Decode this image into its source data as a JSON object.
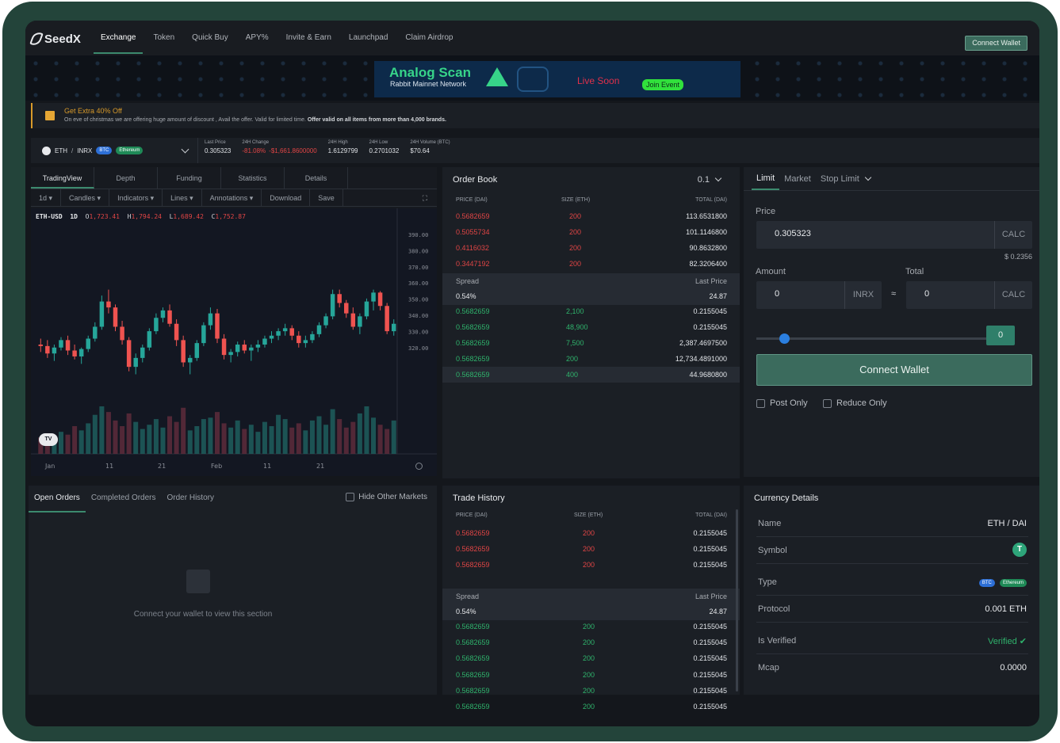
{
  "brand": "SeedX",
  "nav": {
    "links": [
      "Exchange",
      "Token",
      "Quick Buy",
      "APY%",
      "Invite & Earn",
      "Launchpad",
      "Claim Airdrop"
    ],
    "connect_label": "Connect Wallet"
  },
  "ad": {
    "title": "Analog Scan",
    "subtitle": "Rabbit Mainnet Network",
    "live": "Live Soon",
    "join": "Join Event"
  },
  "promo": {
    "title": "Get Extra 40% Off",
    "text": "On eve of christmas we are offering huge amount of discount , Avail the offer. Valid for limited time.",
    "bold": "Offer valid on all items from more than 4,000 brands."
  },
  "ticker": {
    "base": "ETH",
    "sep": "/",
    "quote": "INRX",
    "badges": [
      "BTC",
      "Ethereum"
    ],
    "stats": [
      {
        "label": "Last Price",
        "values": [
          "0.305323"
        ],
        "colors": [
          "#dfe2e6"
        ]
      },
      {
        "label": "24H Change",
        "values": [
          "-81.08%",
          "-$1,661.8600000"
        ],
        "colors": [
          "#e04545",
          "#e04545"
        ]
      },
      {
        "label": "24H High",
        "values": [
          "1.6129799"
        ],
        "colors": [
          "#dfe2e6"
        ]
      },
      {
        "label": "24H Low",
        "values": [
          "0.2701032"
        ],
        "colors": [
          "#dfe2e6"
        ]
      },
      {
        "label": "24H Volume (BTC)",
        "values": [
          "$70.64"
        ],
        "colors": [
          "#dfe2e6"
        ]
      }
    ]
  },
  "chart_panel": {
    "tabs": [
      "TradingView",
      "Depth",
      "Funding",
      "Statistics",
      "Details"
    ],
    "tools": [
      "1d ▾",
      "Candles ▾",
      "Indicators ▾",
      "Lines ▾",
      "Annotations ▾",
      "Download",
      "Save"
    ],
    "expand": "⛶",
    "ohlc": {
      "symbol": "ETH-USD",
      "interval": "1D",
      "o": "1,723.41",
      "h": "1,794.24",
      "l": "1,689.42",
      "c": "1,752.87"
    },
    "tv_logo": "TV"
  },
  "chart_data": {
    "type": "candlestick",
    "symbol": "ETH-USD",
    "yticks": [
      "390.00",
      "380.00",
      "370.00",
      "360.00",
      "350.00",
      "340.00",
      "330.00",
      "320.00"
    ],
    "ylim": [
      315,
      395
    ],
    "xticks": [
      "Jan",
      "11",
      "21",
      "Feb",
      "11",
      "21"
    ],
    "up_color": "#26a69a",
    "down_color": "#ef5350",
    "candles": [
      [
        331,
        335,
        326,
        330
      ],
      [
        330,
        334,
        322,
        325
      ],
      [
        325,
        331,
        320,
        329
      ],
      [
        329,
        336,
        327,
        334
      ],
      [
        334,
        337,
        324,
        327
      ],
      [
        327,
        331,
        321,
        323
      ],
      [
        323,
        329,
        318,
        328
      ],
      [
        328,
        337,
        326,
        335
      ],
      [
        335,
        346,
        333,
        343
      ],
      [
        343,
        364,
        341,
        360
      ],
      [
        360,
        368,
        352,
        356
      ],
      [
        356,
        358,
        340,
        343
      ],
      [
        343,
        347,
        331,
        334
      ],
      [
        334,
        336,
        313,
        316
      ],
      [
        316,
        325,
        311,
        322
      ],
      [
        322,
        331,
        319,
        329
      ],
      [
        329,
        342,
        327,
        340
      ],
      [
        340,
        352,
        338,
        349
      ],
      [
        349,
        356,
        346,
        354
      ],
      [
        354,
        358,
        343,
        345
      ],
      [
        345,
        348,
        330,
        334
      ],
      [
        334,
        337,
        316,
        319
      ],
      [
        319,
        324,
        311,
        322
      ],
      [
        322,
        334,
        320,
        332
      ],
      [
        332,
        346,
        330,
        344
      ],
      [
        344,
        356,
        341,
        352
      ],
      [
        352,
        355,
        332,
        335
      ],
      [
        335,
        338,
        321,
        324
      ],
      [
        324,
        328,
        319,
        326
      ],
      [
        326,
        333,
        323,
        331
      ],
      [
        331,
        334,
        325,
        327
      ],
      [
        327,
        331,
        320,
        329
      ],
      [
        329,
        334,
        326,
        331
      ],
      [
        331,
        337,
        329,
        335
      ],
      [
        335,
        340,
        332,
        337
      ],
      [
        337,
        342,
        334,
        340
      ],
      [
        340,
        345,
        337,
        342
      ],
      [
        342,
        344,
        334,
        337
      ],
      [
        337,
        340,
        329,
        332
      ],
      [
        332,
        337,
        329,
        334
      ],
      [
        334,
        340,
        332,
        338
      ],
      [
        338,
        346,
        336,
        344
      ],
      [
        344,
        352,
        342,
        350
      ],
      [
        350,
        368,
        348,
        365
      ],
      [
        365,
        368,
        356,
        359
      ],
      [
        359,
        361,
        349,
        352
      ],
      [
        352,
        356,
        341,
        343
      ],
      [
        343,
        352,
        338,
        350
      ],
      [
        350,
        362,
        348,
        360
      ],
      [
        360,
        368,
        354,
        366
      ],
      [
        366,
        367,
        354,
        357
      ],
      [
        357,
        359,
        338,
        340
      ],
      [
        340,
        348,
        337,
        345
      ]
    ],
    "volume": [
      6,
      9,
      7,
      10,
      8,
      14,
      11,
      16,
      22,
      28,
      24,
      18,
      14,
      23,
      17,
      12,
      15,
      19,
      13,
      21,
      17,
      27,
      11,
      14,
      19,
      20,
      24,
      16,
      13,
      18,
      12,
      15,
      10,
      17,
      14,
      22,
      19,
      13,
      16,
      11,
      18,
      21,
      15,
      26,
      19,
      13,
      17,
      23,
      28,
      20,
      15,
      12,
      18
    ]
  },
  "orderbook": {
    "title": "Order Book",
    "precision": "0.1",
    "headers": [
      "PRICE (DAI)",
      "SIZE (ETH)",
      "TOTAL (DAI)"
    ],
    "asks": [
      [
        "0.5682659",
        "200",
        "113.6531800"
      ],
      [
        "0.5055734",
        "200",
        "101.1146800"
      ],
      [
        "0.4116032",
        "200",
        "90.8632800"
      ],
      [
        "0.3447192",
        "200",
        "82.3206400"
      ]
    ],
    "spread_label": "Spread",
    "last_price_label": "Last Price",
    "spread_value": "0.54%",
    "last_price_value": "24.87",
    "bids": [
      [
        "0.5682659",
        "2,100",
        "0.2155045"
      ],
      [
        "0.5682659",
        "48,900",
        "0.2155045"
      ],
      [
        "0.5682659",
        "7,500",
        "2,387.4697500"
      ],
      [
        "0.5682659",
        "200",
        "12,734.4891000"
      ],
      [
        "0.5682659",
        "400",
        "44.9680800"
      ]
    ]
  },
  "trade_form": {
    "tabs": [
      "Limit",
      "Market",
      "Stop Limit"
    ],
    "price_label": "Price",
    "price_value": "0.305323",
    "calc_label": "CALC",
    "price_note": "$ 0.2356",
    "amount_label": "Amount",
    "total_label": "Total",
    "amount_value": "0",
    "amount_unit": "INRX",
    "approx": "≈",
    "total_value": "0",
    "slider_value": "0",
    "slider_level": 0.12,
    "connect_label": "Connect Wallet",
    "post_only": "Post Only",
    "reduce_only": "Reduce Only"
  },
  "orders": {
    "tabs": [
      "Open Orders",
      "Completed Orders",
      "Order History"
    ],
    "hide_other": "Hide Other Markets",
    "empty_message": "Connect your wallet to view this section"
  },
  "trade_history": {
    "title": "Trade History",
    "headers": [
      "PRICE (DAI)",
      "SIZE (ETH)",
      "TOTAL (DAI)"
    ],
    "sells": [
      [
        "0.5682659",
        "200",
        "0.2155045"
      ],
      [
        "0.5682659",
        "200",
        "0.2155045"
      ],
      [
        "0.5682659",
        "200",
        "0.2155045"
      ]
    ],
    "spread_label": "Spread",
    "last_price_label": "Last Price",
    "spread_value": "0.54%",
    "last_price_value": "24.87",
    "buys": [
      [
        "0.5682659",
        "200",
        "0.2155045"
      ],
      [
        "0.5682659",
        "200",
        "0.2155045"
      ],
      [
        "0.5682659",
        "200",
        "0.2155045"
      ],
      [
        "0.5682659",
        "200",
        "0.2155045"
      ],
      [
        "0.5682659",
        "200",
        "0.2155045"
      ],
      [
        "0.5682659",
        "200",
        "0.2155045"
      ]
    ]
  },
  "currency": {
    "title": "Currency Details",
    "name_label": "Name",
    "name_value": "ETH / DAI",
    "symbol_label": "Symbol",
    "symbol_icon": "tether-icon",
    "type_label": "Type",
    "type_badges": [
      "BTC",
      "Ethereum"
    ],
    "protocol_label": "Protocol",
    "protocol_value": "0.001 ETH",
    "verified_label": "Is Verified",
    "verified_value": "Verified ✔",
    "mcap_label": "Mcap",
    "mcap_value": "0.0000"
  },
  "colors": {
    "accent": "#3c8a6e",
    "buy": "#2fb36c",
    "sell": "#e04545",
    "bg": "#14171c",
    "panel": "#1b1f25"
  }
}
